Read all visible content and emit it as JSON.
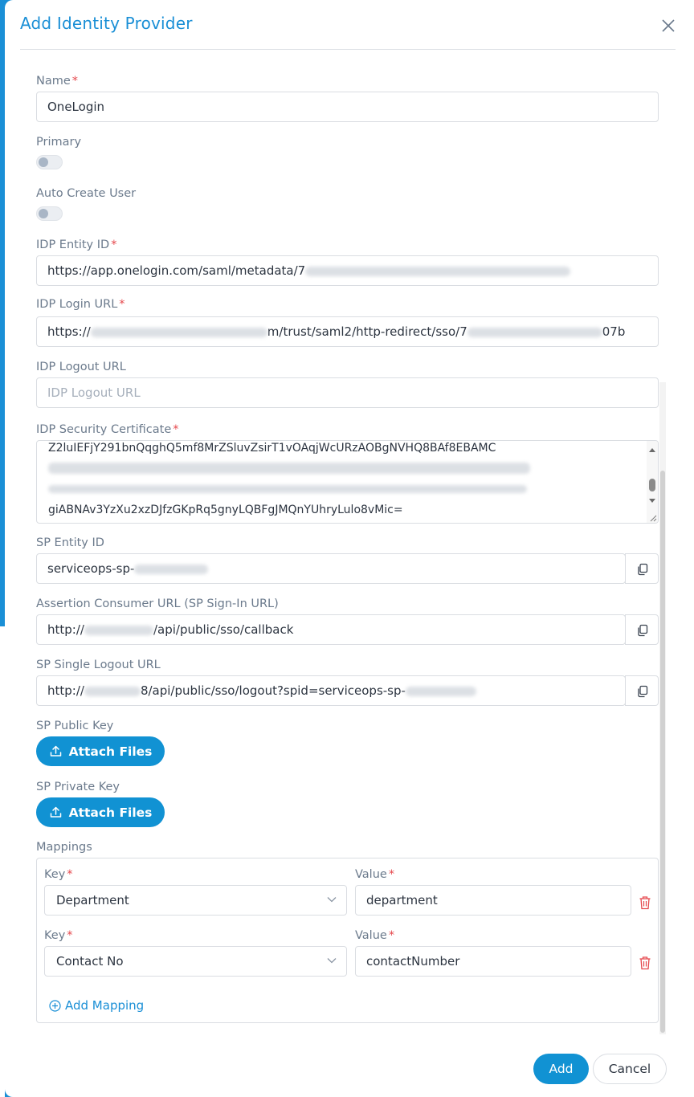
{
  "modal": {
    "title": "Add Identity Provider"
  },
  "form": {
    "name": {
      "label": "Name",
      "value": "OneLogin"
    },
    "primary": {
      "label": "Primary"
    },
    "auto_create_user": {
      "label": "Auto Create User"
    },
    "idp_entity_id": {
      "label": "IDP Entity ID",
      "value_prefix": "https://app.onelogin.com/saml/metadata/7"
    },
    "idp_login_url": {
      "label": "IDP Login URL",
      "value_prefix": "https://",
      "value_middle": "m/trust/saml2/http-redirect/sso/7",
      "value_suffix": "07b"
    },
    "idp_logout_url": {
      "label": "IDP Logout URL",
      "placeholder": "IDP Logout URL"
    },
    "idp_security_certificate": {
      "label": "IDP Security Certificate",
      "line_first": "Z2luIEFjY291bnQqghQ5mf8MrZSluvZsirT1vOAqjWcURzAOBgNVHQ8BAf8EBAMC",
      "line_last": "giABNAv3YzXu2xzDJfzGKpRq5gnyLQBFgJMQnYUhryLulo8vMic="
    },
    "sp_entity_id": {
      "label": "SP Entity ID",
      "value_prefix": "serviceops-sp-"
    },
    "assertion_consumer_url": {
      "label": "Assertion Consumer URL (SP Sign-In URL)",
      "value_prefix": "http://",
      "value_suffix": "/api/public/sso/callback"
    },
    "sp_single_logout_url": {
      "label": "SP Single Logout URL",
      "value_prefix": "http://",
      "value_suffix": "8/api/public/sso/logout?spid=serviceops-sp-"
    },
    "sp_public_key": {
      "label": "SP Public Key",
      "button": "Attach Files"
    },
    "sp_private_key": {
      "label": "SP Private Key",
      "button": "Attach Files"
    },
    "mappings": {
      "label": "Mappings",
      "key_label": "Key",
      "value_label": "Value",
      "rows": [
        {
          "key": "Department",
          "value": "department"
        },
        {
          "key": "Contact No",
          "value": "contactNumber"
        }
      ],
      "add_mapping": "Add Mapping"
    }
  },
  "footer": {
    "add": "Add",
    "cancel": "Cancel"
  },
  "colors": {
    "accent": "#1a8fd6",
    "required": "#e5484d",
    "label": "#6b7a8c"
  }
}
